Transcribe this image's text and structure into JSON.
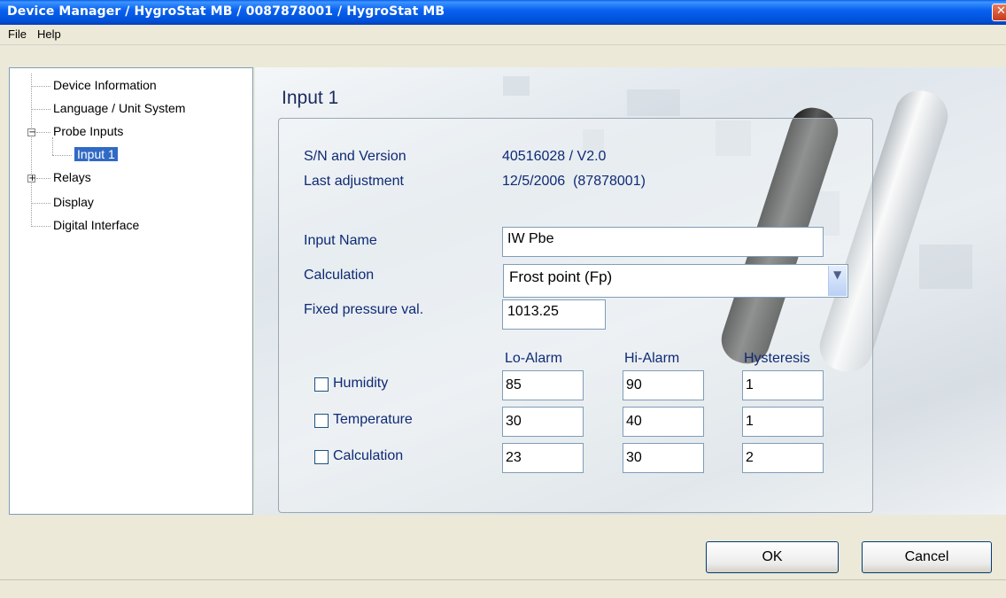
{
  "window": {
    "title": "Device Manager / HygroStat MB / 0087878001 / HygroStat MB",
    "close_glyph": "✕"
  },
  "menu": {
    "items": [
      "File",
      "Help"
    ]
  },
  "tree": {
    "items": [
      {
        "label": "Device Information"
      },
      {
        "label": "Language / Unit System"
      },
      {
        "label": "Probe Inputs",
        "expander": "−"
      },
      {
        "label": "Input 1",
        "selected": true
      },
      {
        "label": "Relays",
        "expander": "+"
      },
      {
        "label": "Display"
      },
      {
        "label": "Digital Interface"
      }
    ]
  },
  "panel": {
    "title": "Input 1",
    "sn_label": "S/N and Version",
    "sn_value": "40516028 / V2.0",
    "adj_label": "Last adjustment",
    "adj_value": "12/5/2006  (87878001)",
    "input_name_label": "Input Name",
    "input_name_value": "IW Pbe",
    "calculation_label": "Calculation",
    "calculation_value": "Frost point (Fp)",
    "pressure_label": "Fixed pressure val.",
    "pressure_value": "1013.25"
  },
  "alarms": {
    "headers": [
      "Lo-Alarm",
      "Hi-Alarm",
      "Hysteresis"
    ],
    "rows": [
      {
        "label": "Humidity",
        "lo": "85",
        "hi": "90",
        "hyst": "1"
      },
      {
        "label": "Temperature",
        "lo": "30",
        "hi": "40",
        "hyst": "1"
      },
      {
        "label": "Calculation",
        "lo": "23",
        "hi": "30",
        "hyst": "2"
      }
    ]
  },
  "buttons": {
    "ok": "OK",
    "cancel": "Cancel"
  },
  "icons": {
    "dropdown": "chevron-down-icon",
    "close": "close-icon"
  },
  "colors": {
    "title_bar": "#0a5ce8",
    "label_text": "#0f2a75",
    "selection": "#316ac5"
  }
}
